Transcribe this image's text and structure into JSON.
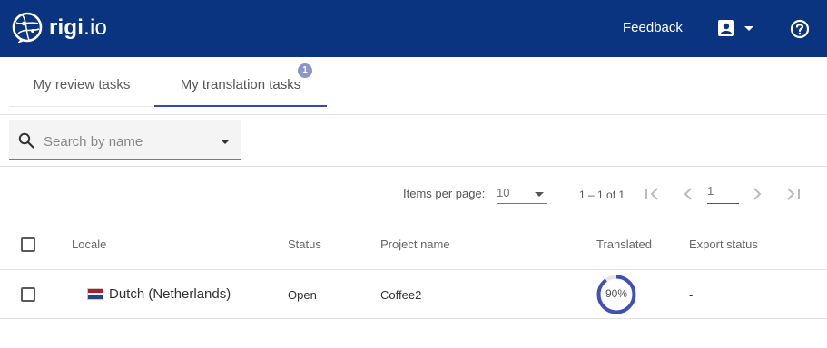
{
  "header": {
    "logo_text_main": "rigi",
    "logo_text_suffix": ".io",
    "feedback_label": "Feedback",
    "brand_color": "#0a3380"
  },
  "tabs": [
    {
      "label": "My review tasks"
    },
    {
      "label": "My translation tasks",
      "badge": "1",
      "active": true
    }
  ],
  "search": {
    "placeholder": "Search by name"
  },
  "pagination": {
    "items_per_page_label": "Items per page:",
    "items_per_page_value": "10",
    "range_text": "1 – 1 of 1",
    "page_value": "1"
  },
  "table": {
    "columns": [
      "Locale",
      "Status",
      "Project name",
      "Translated",
      "Export status"
    ],
    "rows": [
      {
        "locale": "Dutch (Netherlands)",
        "status": "Open",
        "project_name": "Coffee2",
        "translated_percent": 90,
        "translated_label": "90%",
        "export_status": "-"
      }
    ]
  },
  "colors": {
    "accent": "#3548b3",
    "badge": "#8c95cf",
    "progress": "#3f51b5"
  }
}
